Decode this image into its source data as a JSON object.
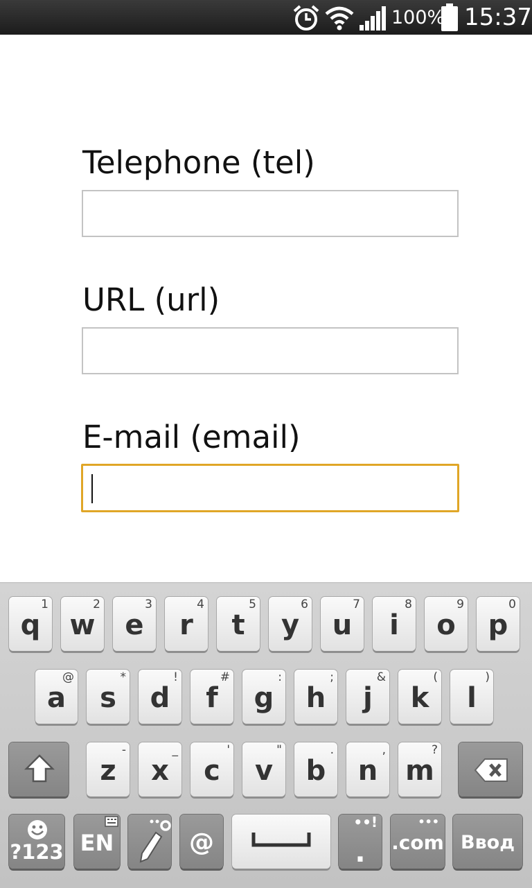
{
  "status_bar": {
    "icons": [
      "alarm-icon",
      "wifi-icon",
      "signal-icon",
      "battery-icon"
    ],
    "battery": "100%",
    "time": "15:37"
  },
  "form": {
    "fields": [
      {
        "label": "Telephone (tel)",
        "value": ""
      },
      {
        "label": "URL (url)",
        "value": ""
      },
      {
        "label": "E-mail (email)",
        "value": ""
      }
    ],
    "focus_color": "#e0a627"
  },
  "keyboard": {
    "row1": [
      {
        "key": "q",
        "sub": "1"
      },
      {
        "key": "w",
        "sub": "2"
      },
      {
        "key": "e",
        "sub": "3"
      },
      {
        "key": "r",
        "sub": "4"
      },
      {
        "key": "t",
        "sub": "5"
      },
      {
        "key": "y",
        "sub": "6"
      },
      {
        "key": "u",
        "sub": "7"
      },
      {
        "key": "i",
        "sub": "8"
      },
      {
        "key": "o",
        "sub": "9"
      },
      {
        "key": "p",
        "sub": "0"
      }
    ],
    "row2": [
      {
        "key": "a",
        "sub": "@"
      },
      {
        "key": "s",
        "sub": "*"
      },
      {
        "key": "d",
        "sub": "!"
      },
      {
        "key": "f",
        "sub": "#"
      },
      {
        "key": "g",
        "sub": ":"
      },
      {
        "key": "h",
        "sub": ";"
      },
      {
        "key": "j",
        "sub": "&"
      },
      {
        "key": "k",
        "sub": "("
      },
      {
        "key": "l",
        "sub": ")"
      }
    ],
    "row3": [
      {
        "key": "z",
        "sub": "-"
      },
      {
        "key": "x",
        "sub": "_"
      },
      {
        "key": "c",
        "sub": "'"
      },
      {
        "key": "v",
        "sub": "\""
      },
      {
        "key": "b",
        "sub": "."
      },
      {
        "key": "n",
        "sub": ","
      },
      {
        "key": "m",
        "sub": "?"
      }
    ],
    "symbols_key": "?123",
    "language_key": "EN",
    "at_key": "@",
    "period_key": ".",
    "dotcom_key": ".com",
    "enter_key": "Ввод"
  }
}
